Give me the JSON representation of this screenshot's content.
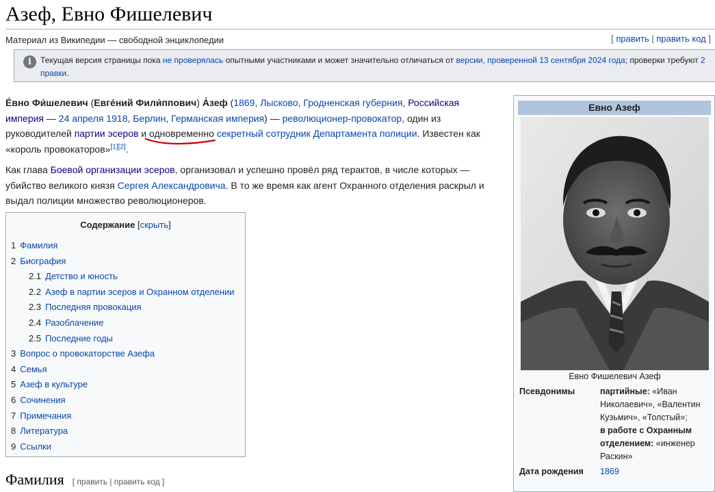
{
  "page": {
    "title": "Азеф, Евно Фишелевич",
    "tagline": "Материал из Википедии — свободной энциклопедии",
    "edit": {
      "open": "[ ",
      "edit": "править",
      "sep": " | ",
      "edit_source": "править код",
      "close": " ]"
    }
  },
  "notice": {
    "icon": "info-icon",
    "t1": "Текущая версия страницы пока ",
    "l1": "не проверялась",
    "t2": " опытными участниками и может значительно отличаться от ",
    "l2": "версии, проверенной 13 сентября 2024 года",
    "t3": "; проверки требуют ",
    "l3": "2 правки",
    "t4": "."
  },
  "lead": {
    "p1": {
      "name1": "Е́вно Фи́шелевич",
      "t1": " (",
      "name2": "Евге́ний Фили́ппович",
      "t2": ") ",
      "name3": "А́зеф",
      "t3": " (",
      "l_1869": "1869",
      "t4": ", ",
      "l_lyskovo": "Лысково",
      "t5": ", ",
      "l_grodno": "Гродненская губерния",
      "t6": ", ",
      "l_empire": "Российская империя",
      "t7": " — ",
      "l_date": "24 апреля 1918",
      "t8": ", ",
      "l_berlin": "Берлин",
      "t9": ", ",
      "l_german": "Германская империя",
      "t10": ") — ",
      "l_rev": "революционер-провокатор",
      "t11": ", один из руководителей ",
      "l_sr": "партии эсеров",
      "t12": " и одновременно ",
      "l_agent": "секретный сотрудник Департамента полиции",
      "t13": ". Известен как «король провокаторов»",
      "ref1": "[1]",
      "ref2": "[2]",
      "t14": "."
    },
    "p2": {
      "t1": "Как глава ",
      "l_boevaya": "Боевой организации эсеров",
      "t2": ", организовал и успешно провёл ряд терактов, в числе которых — убийство великого князя ",
      "l_sergei": "Сергея Александровича",
      "t3": ". В то же время как агент Охранного отделения раскрыл и выдал полиции множество революционеров."
    }
  },
  "toc": {
    "title": "Содержание",
    "toggle_open": "[",
    "toggle": "скрыть",
    "toggle_close": "]",
    "items": [
      {
        "num": "1",
        "label": "Фамилия",
        "level": 1
      },
      {
        "num": "2",
        "label": "Биография",
        "level": 1
      },
      {
        "num": "2.1",
        "label": "Детство и юность",
        "level": 2
      },
      {
        "num": "2.2",
        "label": "Азеф в партии эсеров и Охранном отделении",
        "level": 2
      },
      {
        "num": "2.3",
        "label": "Последняя провокация",
        "level": 2
      },
      {
        "num": "2.4",
        "label": "Разоблачение",
        "level": 2
      },
      {
        "num": "2.5",
        "label": "Последние годы",
        "level": 2
      },
      {
        "num": "3",
        "label": "Вопрос о провокаторстве Азефа",
        "level": 1
      },
      {
        "num": "4",
        "label": "Семья",
        "level": 1
      },
      {
        "num": "5",
        "label": "Азеф в культуре",
        "level": 1
      },
      {
        "num": "6",
        "label": "Сочинения",
        "level": 1
      },
      {
        "num": "7",
        "label": "Примечания",
        "level": 1
      },
      {
        "num": "8",
        "label": "Литература",
        "level": 1
      },
      {
        "num": "9",
        "label": "Ссылки",
        "level": 1
      }
    ]
  },
  "section": {
    "heading": "Фамилия",
    "edit": "[ править | править код ]"
  },
  "infobox": {
    "title": "Евно Азеф",
    "caption": "Евно Фишелевич Азеф",
    "pseud_label": "Псевдонимы",
    "pseud_b1": "партийные:",
    "pseud_v1": " «Иван Николаевич», «Валентин Кузьмич», «Толстый»;",
    "pseud_b2": "в работе с Охранным отделением:",
    "pseud_v2": " «инженер Раскин»",
    "birth_label": "Дата рождения",
    "birth_value": "1869"
  },
  "colors": {
    "link": "#0645ad",
    "visited_link": "#0b0080",
    "infobox_header": "#b0c4de",
    "notice_bg": "#eaecf0",
    "underline_annotation": "#d00000"
  }
}
